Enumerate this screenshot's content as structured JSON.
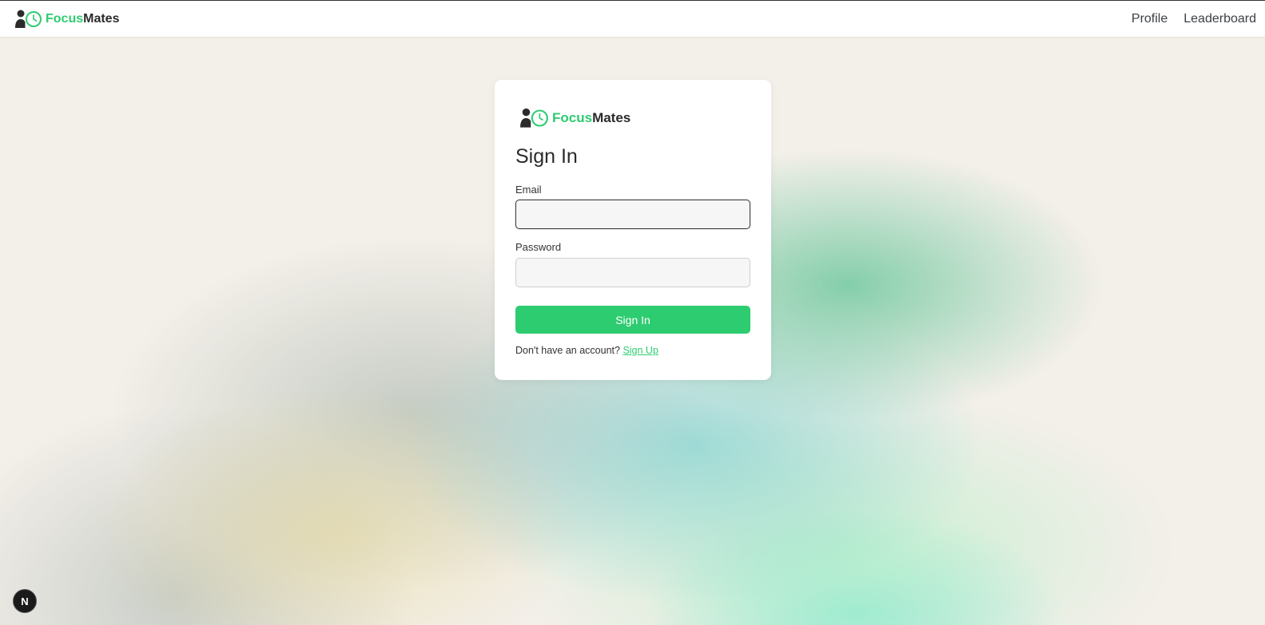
{
  "navbar": {
    "brand": {
      "part1": "Focus",
      "part2": "Mates"
    },
    "links": [
      {
        "label": "Profile"
      },
      {
        "label": "Leaderboard"
      }
    ]
  },
  "card": {
    "brand": {
      "part1": "Focus",
      "part2": "Mates"
    },
    "title": "Sign In",
    "email_label": "Email",
    "email_value": "",
    "password_label": "Password",
    "password_value": "",
    "submit_label": "Sign In",
    "footer_prompt": "Don't have an account?",
    "footer_link": "Sign Up"
  },
  "dev_badge": {
    "label": "N"
  },
  "colors": {
    "accent": "#2ecc71",
    "text_dark": "#2b2b2b",
    "background": "#f3efe9"
  },
  "icons": {
    "brand_logo": "user-clock-icon",
    "dev_badge": "nextjs-icon"
  }
}
